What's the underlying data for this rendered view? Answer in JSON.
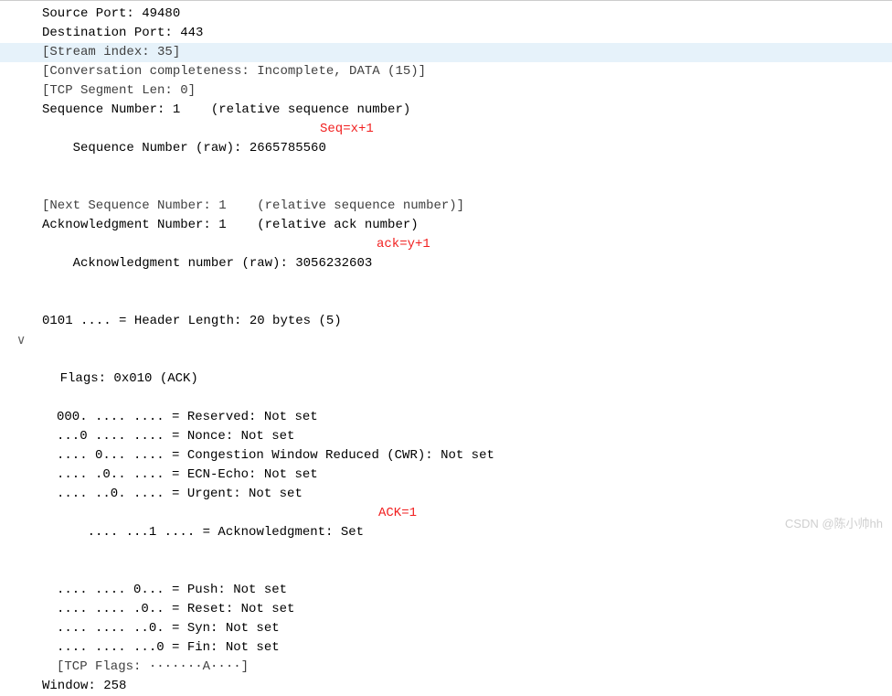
{
  "lines": {
    "src_port": "Source Port: 49480",
    "dst_port": "Destination Port: 443",
    "stream_index": "[Stream index: 35]",
    "conv_comp": "[Conversation completeness: Incomplete, DATA (15)]",
    "seg_len": "[TCP Segment Len: 0]",
    "seq_rel": "Sequence Number: 1    (relative sequence number)",
    "seq_raw": "Sequence Number (raw): 2665785560",
    "next_seq": "[Next Sequence Number: 1    (relative sequence number)]",
    "ack_rel": "Acknowledgment Number: 1    (relative ack number)",
    "ack_raw": "Acknowledgment number (raw): 3056232603",
    "hdr_len": "0101 .... = Header Length: 20 bytes (5)",
    "flags_main": "Flags: 0x010 (ACK)",
    "f_reserved": "000. .... .... = Reserved: Not set",
    "f_nonce": "...0 .... .... = Nonce: Not set",
    "f_cwr": ".... 0... .... = Congestion Window Reduced (CWR): Not set",
    "f_ecn": ".... .0.. .... = ECN-Echo: Not set",
    "f_urg": ".... ..0. .... = Urgent: Not set",
    "f_ack": ".... ...1 .... = Acknowledgment: Set",
    "f_psh": ".... .... 0... = Push: Not set",
    "f_rst": ".... .... .0.. = Reset: Not set",
    "f_syn": ".... .... ..0. = Syn: Not set",
    "f_fin": ".... .... ...0 = Fin: Not set",
    "tcp_flags": "[TCP Flags: ·······A····]",
    "window": "Window: 258"
  },
  "annotations": {
    "seq": "Seq=x+1",
    "ack_raw": "ack=y+1",
    "ack_flag": "ACK=1"
  },
  "toggle_glyph": "∨",
  "watermark": "CSDN @陈小帅hh"
}
